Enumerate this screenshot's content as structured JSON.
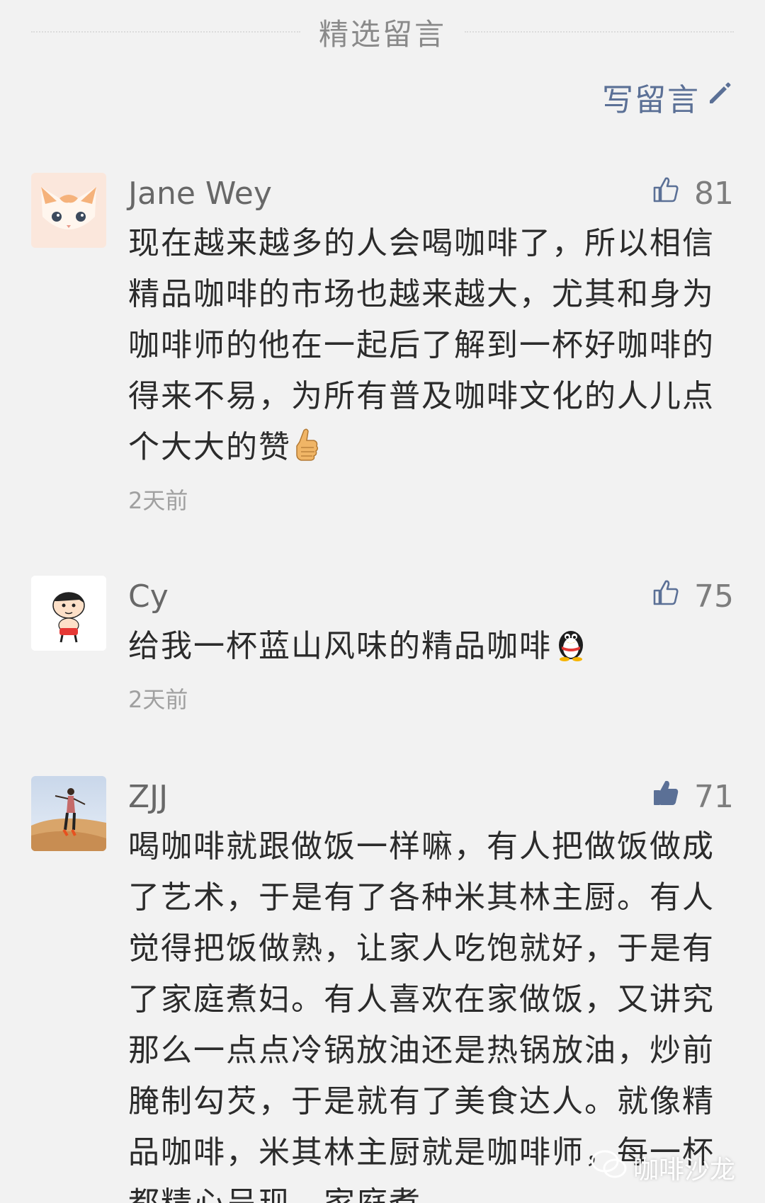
{
  "header": {
    "section_title": "精选留言",
    "write_comment_label": "写留言"
  },
  "comments": [
    {
      "nickname": "Jane Wey",
      "like_count": "81",
      "content": "现在越来越多的人会喝咖啡了，所以相信精品咖啡的市场也越来越大，尤其和身为咖啡师的他在一起后了解到一杯好咖啡的得来不易，为所有普及咖啡文化的人儿点个大大的赞",
      "emoji": "thumbs-up-emoji",
      "time": "2天前",
      "liked": false
    },
    {
      "nickname": "Cy",
      "like_count": "75",
      "content": "给我一杯蓝山风味的精品咖啡",
      "emoji": "penguin-emoji",
      "time": "2天前",
      "liked": false
    },
    {
      "nickname": "ZJJ",
      "like_count": "71",
      "content": "喝咖啡就跟做饭一样嘛，有人把做饭做成了艺术，于是有了各种米其林主厨。有人觉得把饭做熟，让家人吃饱就好，于是有了家庭煮妇。有人喜欢在家做饭，又讲究那么一点点冷锅放油还是热锅放油，炒前腌制勾芡，于是就有了美食达人。就像精品咖啡，米其林主厨就是咖啡师，每一杯都精心呈现，家庭煮",
      "time": "",
      "liked": true
    }
  ],
  "watermark": "咖啡沙龙",
  "colors": {
    "background": "#f2f2f2",
    "link_blue": "#5b7096",
    "liked_blue": "#5b7096"
  }
}
